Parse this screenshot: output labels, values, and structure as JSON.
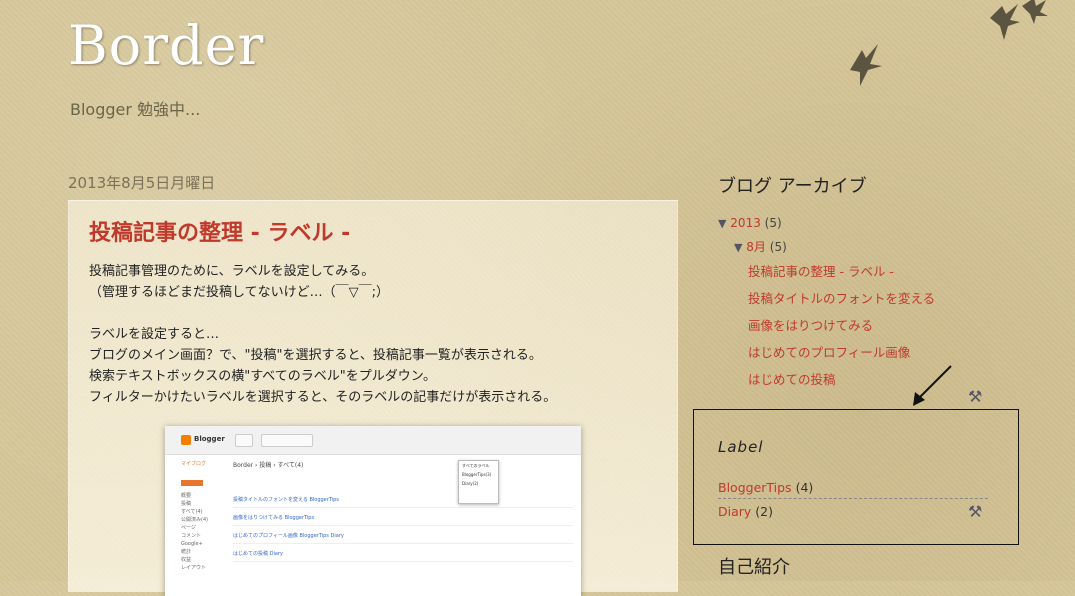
{
  "header": {
    "title": "Border",
    "description": "Blogger 勉強中..."
  },
  "post": {
    "date": "2013年8月5日月曜日",
    "title": "投稿記事の整理 - ラベル -",
    "body": [
      "投稿記事管理のために、ラベルを設定してみる。",
      "（管理するほどまだ投稿してないけど…（￣▽￣;）",
      "",
      "ラベルを設定すると…",
      "ブログのメイン画面？で、\"投稿\"を選択すると、投稿記事一覧が表示される。",
      "検索テキストボックスの横\"すべてのラベル\"をプルダウン。",
      "フィルターかけたいラベルを選択すると、そのラベルの記事だけが表示される。"
    ],
    "screenshot": {
      "logo": "Blogger",
      "blog_label": "ブログを作成",
      "crumb": "Border › 投稿 › すべて(4)",
      "sidebar": [
        "マイブログ",
        "新しい投稿",
        "概要",
        "投稿",
        "すべて(4)",
        "公開済み(4)",
        "ページ",
        "コメント",
        "Google+",
        "統計",
        "収益",
        "レイアウト"
      ],
      "rows": [
        "投稿タイトルのフォントを変える BloggerTips",
        "画像をはりつけてみる BloggerTips",
        "はじめてのプロフィール画像 BloggerTips Diary",
        "はじめての投稿 Diary"
      ],
      "dropdown": [
        "すべてのラベル",
        "BloggerTips(3)",
        "Diary(2)"
      ]
    }
  },
  "archive": {
    "heading": "ブログ アーカイブ",
    "year": {
      "arrow": "▼",
      "label": "2013",
      "count": "(5)"
    },
    "month": {
      "arrow": "▼",
      "label": "8月",
      "count": "(5)"
    },
    "posts": [
      "投稿記事の整理 - ラベル -",
      "投稿タイトルのフォントを変える",
      "画像をはりつけてみる",
      "はじめてのプロフィール画像",
      "はじめての投稿"
    ]
  },
  "labels": {
    "heading": "Label",
    "items": [
      {
        "name": "BloggerTips",
        "count": "(4)"
      },
      {
        "name": "Diary",
        "count": "(2)"
      }
    ]
  },
  "profile": {
    "heading": "自己紹介"
  },
  "icons": {
    "edit": "wrench-screwdriver-icon",
    "arrow": "arrow-pointer-icon"
  },
  "colors": {
    "link": "#c0392b",
    "background": "#d6c698"
  }
}
